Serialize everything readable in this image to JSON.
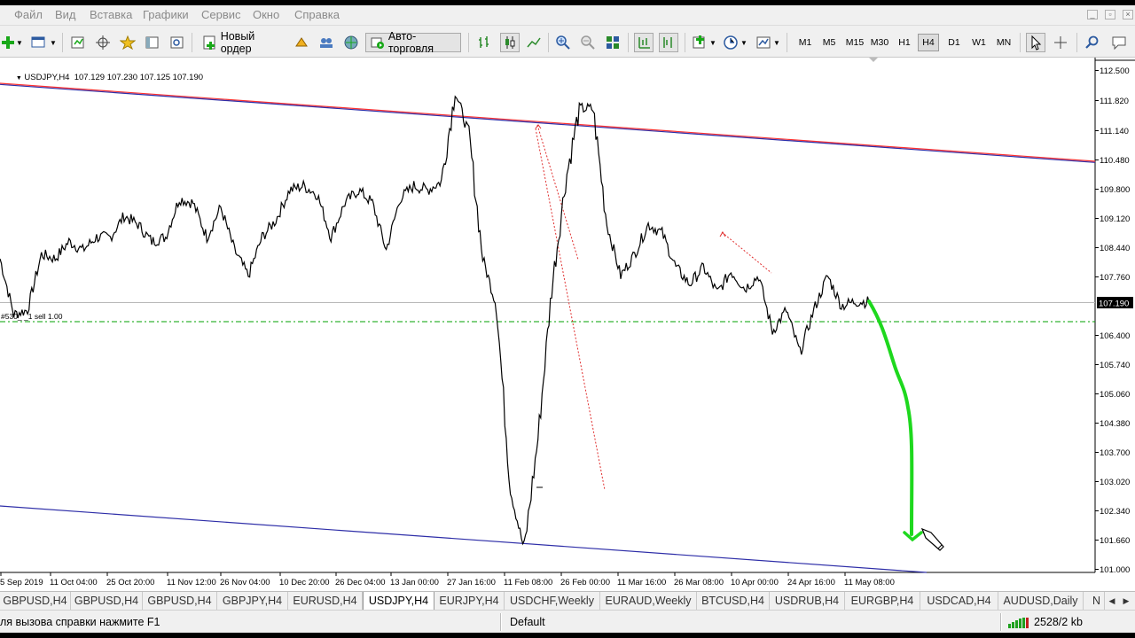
{
  "menu": [
    "Файл",
    "Вид",
    "Вставка",
    "Графики",
    "Сервис",
    "Окно",
    "Справка"
  ],
  "toolbar": {
    "new_order_label": "Новый ордер",
    "autotrade_label": "Авто-торговля",
    "timeframes": [
      "M1",
      "M5",
      "M15",
      "M30",
      "H1",
      "H4",
      "D1",
      "W1",
      "MN"
    ],
    "active_timeframe": "H4"
  },
  "chart": {
    "symbol_info": "USDJPY,H4  107.129 107.230 107.125 107.190",
    "current_price": "107.190",
    "order_label": "#530_ _1 sell 1.00",
    "price_labels": [
      "112.500",
      "111.820",
      "111.140",
      "110.480",
      "109.800",
      "109.120",
      "108.440",
      "107.760",
      "107.190",
      "106.400",
      "105.740",
      "105.060",
      "104.380",
      "103.700",
      "103.020",
      "102.340",
      "101.660",
      "101.000"
    ],
    "time_labels": [
      "5 Sep 2019",
      "11 Oct 04:00",
      "25 Oct 20:00",
      "11 Nov 12:00",
      "26 Nov 04:00",
      "10 Dec 20:00",
      "26 Dec 04:00",
      "13 Jan 00:00",
      "27 Jan 16:00",
      "11 Feb 08:00",
      "26 Feb 00:00",
      "11 Mar 16:00",
      "26 Mar 08:00",
      "10 Apr 00:00",
      "24 Apr 16:00",
      "11 May 08:00"
    ],
    "colors": {
      "price_line": "#000000",
      "channel_top": "#ff0000",
      "channel_line": "#2e2ea8",
      "order_line": "#00a000",
      "forecast_arrow": "#1ed81e",
      "trade_line": "#ff0000"
    },
    "chart_data": {
      "type": "line",
      "series": [
        {
          "values": [
            108.2,
            106.9,
            107.0,
            108.3,
            108.2,
            108.6,
            108.4,
            108.7,
            108.7,
            109.2,
            109.0,
            108.6,
            108.7,
            109.6,
            109.5,
            108.7,
            109.4,
            108.4,
            107.8,
            108.7,
            109.1,
            109.8,
            109.9,
            109.7,
            108.7,
            109.5,
            109.8,
            109.5,
            108.4,
            109.6,
            109.9,
            109.8,
            110.0,
            112.1,
            111.1,
            108.2,
            107.1,
            102.8,
            101.4,
            104.0,
            107.5,
            110.0,
            111.7,
            111.7,
            109.0,
            107.8,
            108.3,
            109.0,
            108.8,
            108.0,
            107.6,
            108.0,
            107.4,
            107.9,
            107.5,
            107.8,
            106.5,
            107.0,
            106.0,
            107.0,
            107.8,
            107.1,
            107.2,
            107.19
          ]
        }
      ],
      "ylim": [
        101.0,
        112.5
      ]
    }
  },
  "tabs": [
    "GBPUSD,H4",
    "GBPUSD,H4",
    "GBPUSD,H4",
    "GBPJPY,H4",
    "EURUSD,H4",
    "USDJPY,H4",
    "EURJPY,H4",
    "USDCHF,Weekly",
    "EURAUD,Weekly",
    "BTCUSD,H4",
    "USDRUB,H4",
    "EURGBP,H4",
    "USDCAD,H4",
    "AUDUSD,Daily",
    "N"
  ],
  "active_tab": 5,
  "status": {
    "help": "ля вызова справки нажмите F1",
    "profile": "Default",
    "traffic": "2528/2 kb"
  }
}
